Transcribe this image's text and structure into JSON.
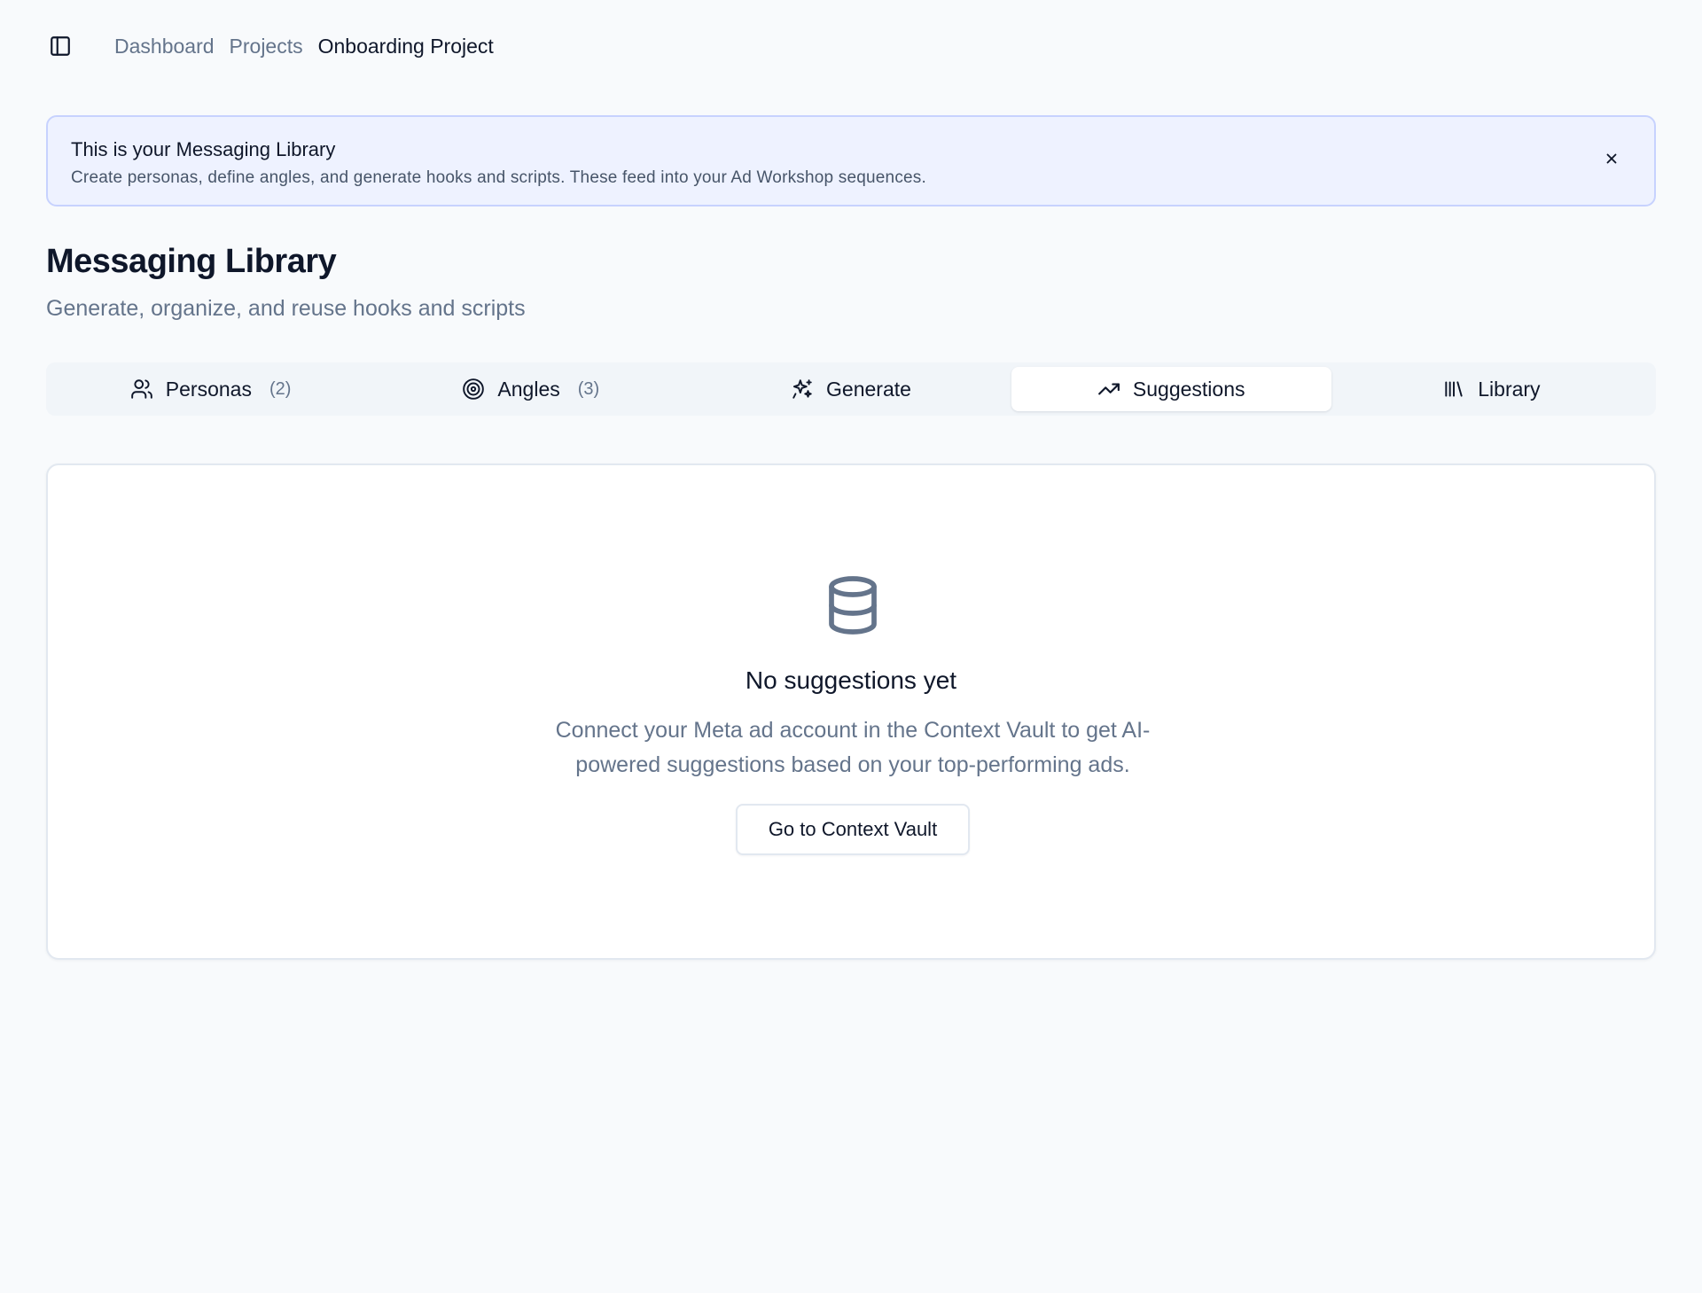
{
  "header": {
    "sidebar_toggle_icon": "panel-left-icon",
    "breadcrumb": [
      {
        "label": "Dashboard"
      },
      {
        "label": "Projects"
      },
      {
        "label": "Onboarding Project"
      }
    ]
  },
  "banner": {
    "title": "This is your Messaging Library",
    "description": "Create personas, define angles, and generate hooks and scripts. These feed into your Ad Workshop sequences.",
    "close_icon": "close-icon"
  },
  "page": {
    "title": "Messaging Library",
    "subtitle": "Generate, organize, and reuse hooks and scripts"
  },
  "tabs": [
    {
      "label": "Personas",
      "count": "(2)",
      "icon": "users-icon"
    },
    {
      "label": "Angles",
      "count": "(3)",
      "icon": "target-icon"
    },
    {
      "label": "Generate",
      "icon": "sparkles-icon"
    },
    {
      "label": "Suggestions",
      "icon": "trending-up-icon",
      "active": true
    },
    {
      "label": "Library",
      "icon": "library-icon"
    }
  ],
  "empty_state": {
    "icon": "database-icon",
    "title": "No suggestions yet",
    "description": "Connect your Meta ad account in the Context Vault to get AI-powered suggestions based on your top-performing ads.",
    "button_label": "Go to Context Vault"
  },
  "colors": {
    "background": "#f8fafc",
    "banner_bg": "#eef2ff",
    "banner_border": "#c7d2fe",
    "muted_text": "#64748b",
    "text": "#0f172a"
  }
}
